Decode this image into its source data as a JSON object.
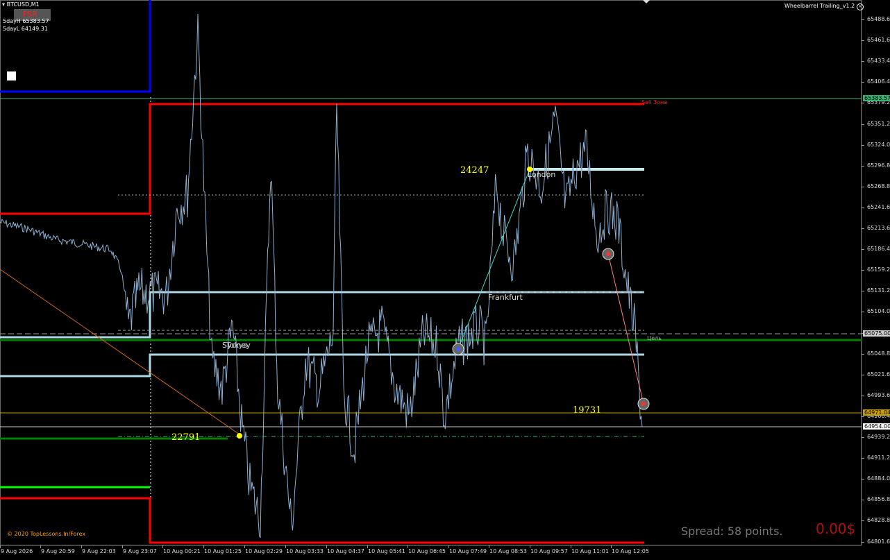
{
  "header": {
    "symbol": "BTCUSD,M1",
    "indicator": "Wheelbarrel Trailing_v1.2",
    "fsr": "FSR",
    "day_high": "5dayH 65383.57",
    "day_low": "5dayL 64149.31",
    "copyright": "© 2020 TopLessons.In/Forex"
  },
  "overlay": {
    "spread": "Spread: 58 points.",
    "profit": "0.00$",
    "sell_zone": "Sell Зона",
    "target": "Цель",
    "label_24247": "24247",
    "label_22791": "22791",
    "label_19731": "19731",
    "session_london": "London",
    "session_frankfurt": "Frankfurt",
    "session_sydney": "Sydney",
    "session_tokyo": "Tokyo"
  },
  "price_axis": {
    "ticks": [
      "65488.60",
      "65461.60",
      "65433.40",
      "65406.40",
      "65379.20",
      "65351.20",
      "65324.00",
      "65296.80",
      "65268.80",
      "65241.60",
      "65213.60",
      "65186.40",
      "65159.20",
      "65131.20",
      "65104.00",
      "65076.00",
      "65048.80",
      "65021.60",
      "64993.60",
      "64966.40",
      "64939.20",
      "64911.20",
      "64884.00",
      "64856.80",
      "64828.80",
      "64801.60"
    ],
    "tag_current": "65383.57",
    "tag_target": "65075.00",
    "tag_bid": "64971.04",
    "tag_ask": "64954.00",
    "tag_covered": "64966.40"
  },
  "time_axis": {
    "ticks": [
      "9 Aug 2026",
      "9 Aug 20:59",
      "9 Aug 22:03",
      "9 Aug 23:07",
      "10 Aug 00:21",
      "10 Aug 01:25",
      "10 Aug 02:29",
      "10 Aug 03:33",
      "10 Aug 04:37",
      "10 Aug 05:41",
      "10 Aug 06:45",
      "10 Aug 07:49",
      "10 Aug 08:53",
      "10 Aug 09:57",
      "10 Aug 11:01",
      "10 Aug 12:05"
    ]
  },
  "colors": {
    "background": "#000000",
    "price_line": "#8fb0d0",
    "red_level": "#ff0000",
    "blue_level": "#0000ff",
    "lightblue_level": "#add8e6",
    "green_level": "#008000",
    "lime_level": "#00ff00",
    "yellow_text": "#ffff00",
    "gold_line": "#c8a000"
  }
}
